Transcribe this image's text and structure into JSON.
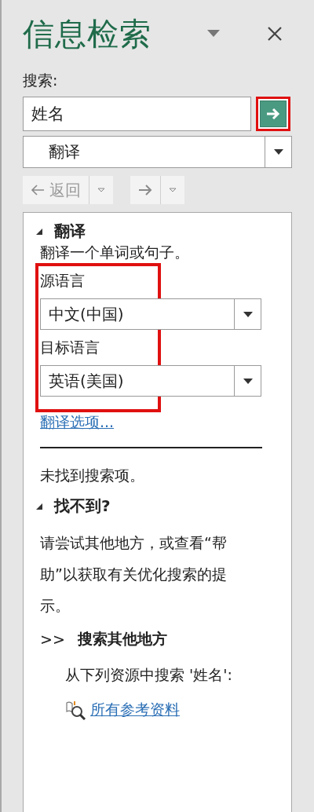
{
  "pane": {
    "title": "信息检索"
  },
  "search": {
    "label": "搜索:",
    "value": "姓名",
    "go_highlighted": true
  },
  "service": {
    "value": "翻译"
  },
  "nav": {
    "back": {
      "label": "返回",
      "disabled": true
    },
    "forward": {
      "disabled": true
    }
  },
  "translate": {
    "heading": "翻译",
    "expanded": true,
    "description": "翻译一个单词或句子。",
    "languages_highlighted": true,
    "source_label": "源语言",
    "source": "中文(中国)",
    "target_label": "目标语言",
    "target": "英语(美国)",
    "options_link": "翻译选项..."
  },
  "results": {
    "message": "未找到搜索项。",
    "heading": "找不到?",
    "expanded": true,
    "hint": "请尝试其他地方，或查看“帮助”以获取有关优化搜索的提示。",
    "more_marker": ">>",
    "more_heading": "搜索其他地方",
    "more_text": "从下列资源中搜索 '姓名':",
    "source_link": "所有参考资料"
  }
}
